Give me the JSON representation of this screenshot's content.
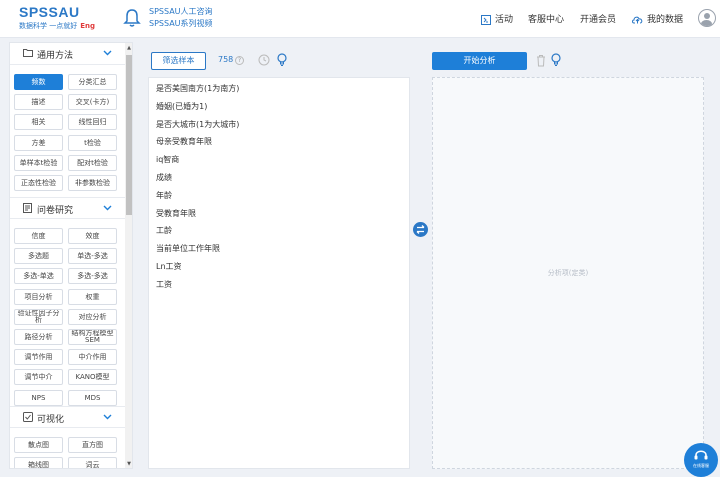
{
  "header": {
    "logo_main": "SPSSAU",
    "logo_sub": "数据科学 一点就好",
    "logo_tag": "Eng",
    "notices": [
      "SPSSAU人工咨询",
      "SPSSAU系列视频"
    ],
    "nav": [
      {
        "label": "活动",
        "icon": "activity-icon"
      },
      {
        "label": "客服中心",
        "icon": "none"
      },
      {
        "label": "开通会员",
        "icon": "none"
      },
      {
        "label": "我的数据",
        "icon": "cloud-upload-icon"
      }
    ]
  },
  "sidebar": {
    "sections": [
      {
        "title": "通用方法",
        "icon": "folder-icon",
        "items": [
          "频数",
          "分类汇总",
          "描述",
          "交叉(卡方)",
          "相关",
          "线性回归",
          "方差",
          "t检验",
          "单样本t检验",
          "配对t检验",
          "正态性检验",
          "非参数检验"
        ],
        "active": 0
      },
      {
        "title": "问卷研究",
        "icon": "document-icon",
        "items": [
          "信度",
          "效度",
          "多选题",
          "单选-多选",
          "多选-单选",
          "多选-多选",
          "项目分析",
          "权重",
          "验证性因子分析",
          "对应分析",
          "路径分析",
          "结构方程模型SEM",
          "调节作用",
          "中介作用",
          "调节中介",
          "KANO模型",
          "NPS",
          "MDS"
        ]
      },
      {
        "title": "可视化",
        "icon": "check-square-icon",
        "items": [
          "散点图",
          "直方图",
          "箱线图",
          "词云"
        ]
      }
    ]
  },
  "variables": {
    "filter_label": "筛选样本",
    "count": "758",
    "items": [
      "是否美国南方(1为南方)",
      "婚姻(已婚为1)",
      "是否大城市(1为大城市)",
      "母亲受教育年限",
      "iq智商",
      "成绩",
      "年龄",
      "受教育年限",
      "工龄",
      "当前单位工作年限",
      "Ln工资",
      "工资"
    ]
  },
  "analysis": {
    "start_label": "开始分析",
    "placeholder": "分析项(定类)"
  },
  "help": {
    "label": "在线客服"
  },
  "colors": {
    "primary": "#1e7fd8",
    "brand": "#2b78c6",
    "accent_red": "#e03c3c"
  }
}
